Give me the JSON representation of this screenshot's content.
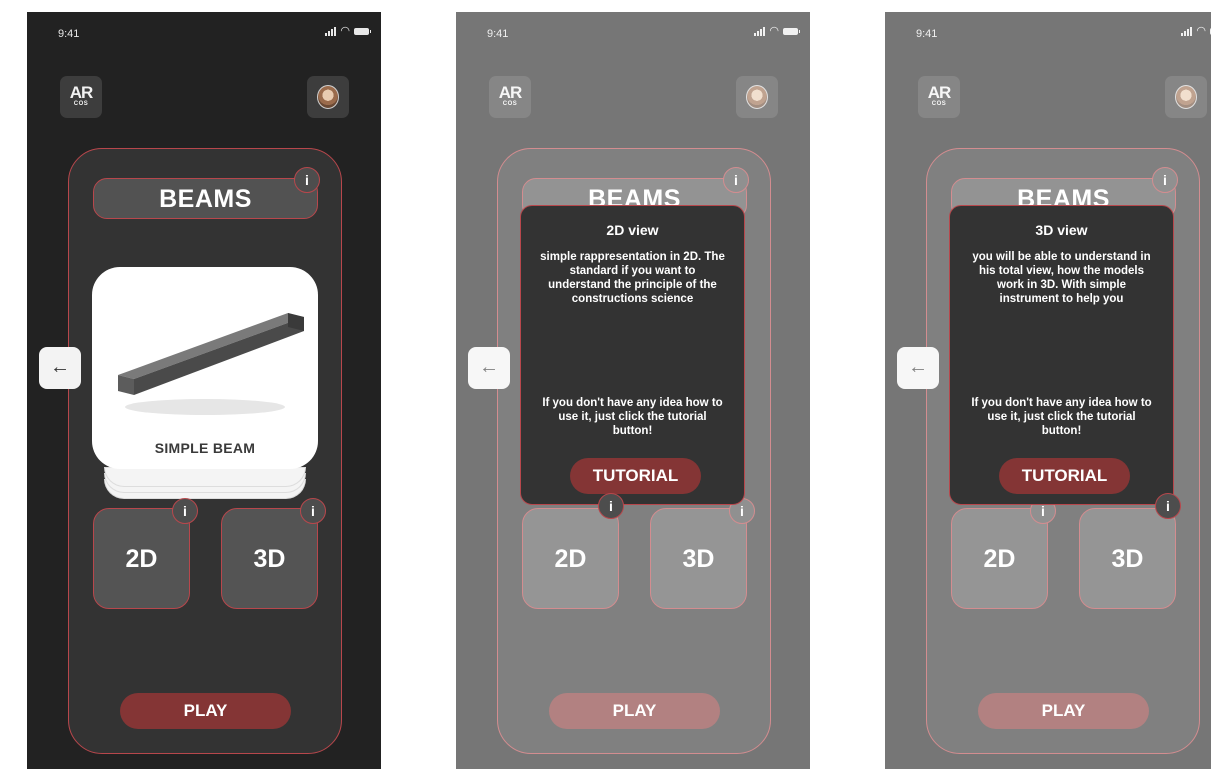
{
  "status_bar": {
    "time": "9:41"
  },
  "logo": {
    "line1": "AR",
    "line2": "COS"
  },
  "main_card": {
    "title": "BEAMS",
    "info_symbol": "i",
    "model_label": "SIMPLE BEAM",
    "mode_2d_label": "2D",
    "mode_3d_label": "3D",
    "play_label": "PLAY",
    "back_symbol": "←"
  },
  "popup_2d": {
    "title": "2D view",
    "description": "simple rappresentation in 2D. The standard if you want to understand the principle of the constructions science",
    "help": "If you don't have any idea how to use it, just click the tutorial button!",
    "button": "TUTORIAL"
  },
  "popup_3d": {
    "title": "3D view",
    "description": "you will be able to understand in his total view, how the models work in 3D. With simple instrument to help you",
    "help": "If you don't have any idea how to use it, just click the tutorial button!",
    "button": "TUTORIAL"
  },
  "colors": {
    "background": "#222222",
    "card": "#333333",
    "border_accent": "#b8474c",
    "play_button": "#843535"
  },
  "icons": {
    "info": "info-icon",
    "back": "arrow-left-icon",
    "avatar": "user-avatar",
    "signal": "cellular-signal-icon",
    "wifi": "wifi-icon",
    "battery": "battery-icon"
  }
}
